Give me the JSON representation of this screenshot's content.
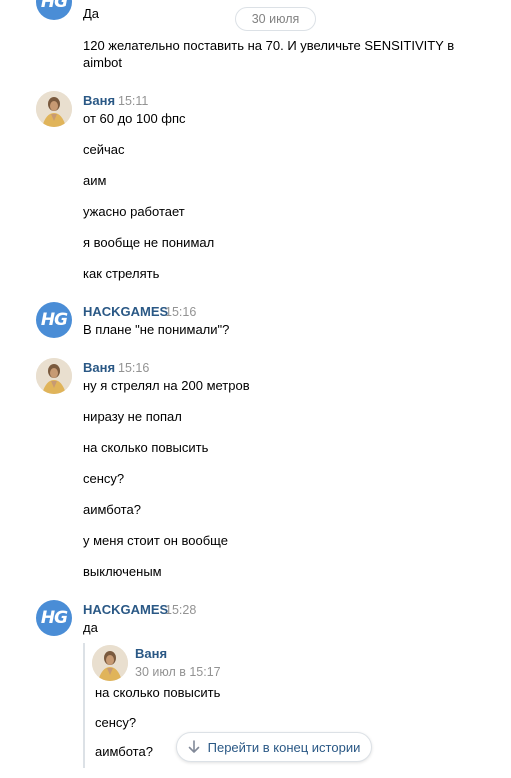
{
  "date_badge": "30 июля",
  "messages": {
    "m0": {
      "lines": [
        "Да",
        "120 желательно поставить на 70. И увеличьте SENSITIVITY в",
        "aimbot"
      ]
    },
    "m1": {
      "author": "Ваня",
      "time": "15:11",
      "lines": [
        "от 60 до 100 фпс",
        "сейчас",
        "аим",
        "ужасно работает",
        "я вообще не понимал",
        "как стрелять"
      ]
    },
    "m2": {
      "author": "HACKGAMES",
      "time": "15:16",
      "lines": [
        "В плане \"не понимали\"?"
      ]
    },
    "m3": {
      "author": "Ваня",
      "time": "15:16",
      "lines": [
        "ну я стрелял на 200 метров",
        "ниразу не попал",
        "на сколько повысить",
        "сенсу?",
        "аимбота?",
        "у меня стоит он вообще",
        "выключеным"
      ]
    },
    "m4": {
      "author": "HACKGAMES",
      "time": "15:28",
      "lines": [
        "да"
      ]
    }
  },
  "reply": {
    "author": "Ваня",
    "time": "30 июл в 15:17",
    "lines": [
      "на сколько повысить",
      "сенсу?",
      "аимбота?"
    ]
  },
  "avatar_hg_text": "HG",
  "scroll_button": {
    "label": "Перейти в конец истории",
    "icon": "arrow-down-icon"
  },
  "colors": {
    "accent": "#2a5885",
    "hg_avatar": "#4a8dd6",
    "time": "#939393"
  }
}
